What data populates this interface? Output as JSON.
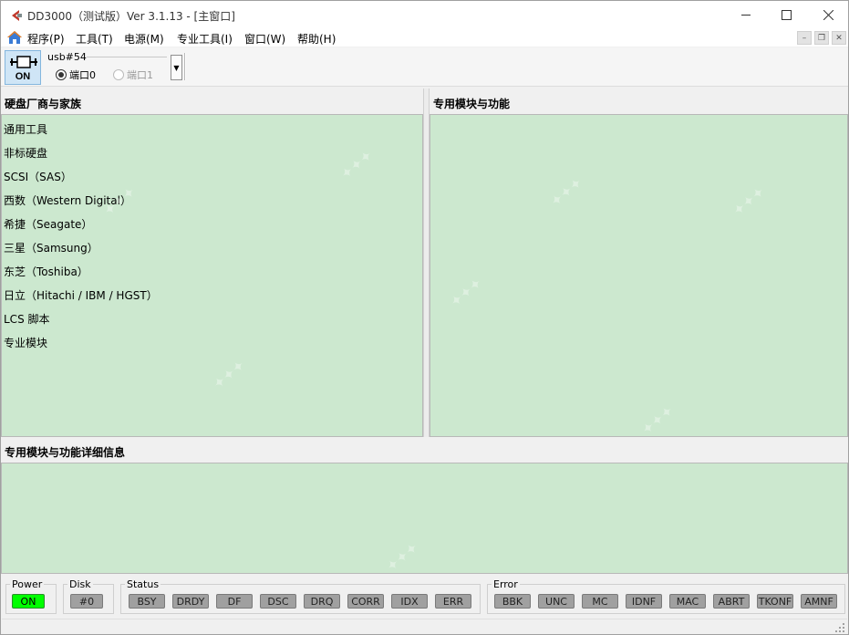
{
  "window": {
    "title": "DD3000（测试版）Ver 3.1.13 - [主窗口]"
  },
  "menu": {
    "items": [
      "程序(P)",
      "工具(T)",
      "电源(M)",
      "专业工具(I)",
      "窗口(W)",
      "帮助(H)"
    ]
  },
  "toolbar": {
    "power_button_label": "ON",
    "device_label": "usb#54",
    "ports": [
      {
        "label": "端口0",
        "selected": true,
        "enabled": true
      },
      {
        "label": "端口1",
        "selected": false,
        "enabled": false
      }
    ]
  },
  "left_panel": {
    "title": "硬盘厂商与家族",
    "items": [
      "通用工具",
      "非标硬盘",
      "SCSI（SAS）",
      "西数（Western Digital）",
      "希捷（Seagate）",
      "三星（Samsung）",
      "东芝（Toshiba）",
      "日立（Hitachi / IBM / HGST）",
      "LCS 脚本",
      "专业模块"
    ]
  },
  "right_panel": {
    "title": "专用模块与功能"
  },
  "detail_panel": {
    "title": "专用模块与功能详细信息"
  },
  "status_area": {
    "power": {
      "title": "Power",
      "value": "ON"
    },
    "disk": {
      "title": "Disk",
      "value": "#0"
    },
    "status": {
      "title": "Status",
      "flags": [
        "BSY",
        "DRDY",
        "DF",
        "DSC",
        "DRQ",
        "CORR",
        "IDX",
        "ERR"
      ]
    },
    "error": {
      "title": "Error",
      "flags": [
        "BBK",
        "UNC",
        "MC",
        "IDNF",
        "MAC",
        "ABRT",
        "TKONF",
        "AMNF"
      ]
    }
  },
  "colors": {
    "panel_bg": "#cce8cf",
    "led_on": "#00ff00",
    "led_off": "#a0a0a0",
    "accent": "#c0392b"
  },
  "icons": {
    "app": "dd3000-logo-icon",
    "home": "home-icon"
  }
}
